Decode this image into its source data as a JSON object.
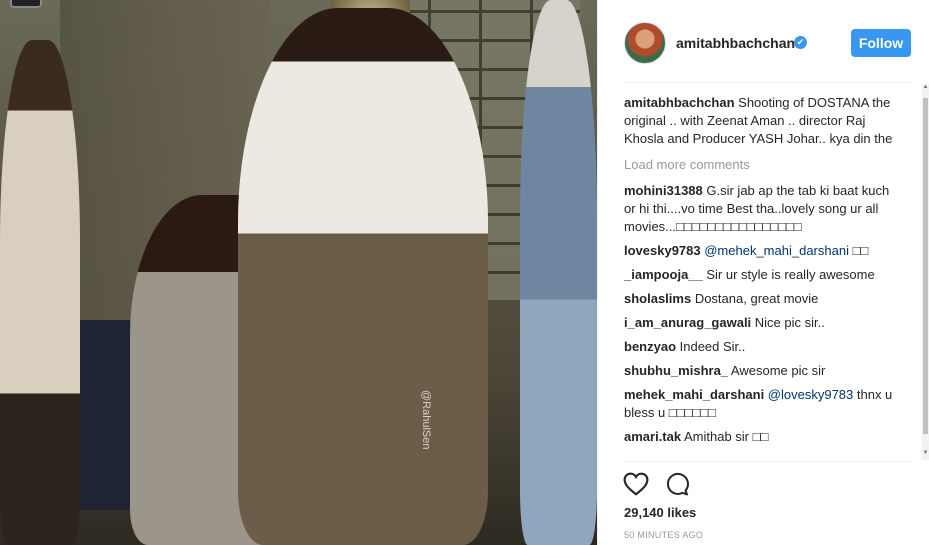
{
  "photo": {
    "watermark": "@RahulSen"
  },
  "post": {
    "username": "amitabhbachchan",
    "verified_badge": "✔",
    "follow_label": "Follow",
    "caption_user": "amitabhbachchan",
    "caption_text": " Shooting of DOSTANA the original .. with Zeenat Aman .. director Raj Khosla and Producer YASH Johar.. kya din the",
    "load_more": "Load more comments",
    "comments": [
      {
        "user": "mohini31388",
        "text": " G.sir jab ap the tab ki baat kuch or hi thi....vo time Best tha..lovely song ur all movies...□□□□□□□□□□□□□□□□"
      },
      {
        "user": "lovesky9783",
        "mention": " @mehek_mahi_darshani",
        "text": " □□"
      },
      {
        "user": "_iampooja__",
        "text": " Sir ur style is really awesome"
      },
      {
        "user": "sholaslims",
        "text": " Dostana, great movie"
      },
      {
        "user": "i_am_anurag_gawali",
        "text": " Nice pic sir.."
      },
      {
        "user": "benzyao",
        "text": " Indeed Sir.."
      },
      {
        "user": "shubhu_mishra_",
        "text": " Awesome pic sir"
      },
      {
        "user": "mehek_mahi_darshani",
        "mention": " @lovesky9783",
        "text": " thnx u bless u □□□□□□"
      },
      {
        "user": "amari.tak",
        "text": " Amithab sir □□"
      }
    ],
    "likes": "29,140 likes",
    "time": "50 MINUTES AGO"
  },
  "colors": {
    "accent": "#3897f0",
    "text": "#262626",
    "muted": "#999999",
    "mention": "#003569"
  },
  "icons": {
    "like": "heart-icon",
    "comment": "comment-icon",
    "verified": "verified-badge-icon"
  }
}
